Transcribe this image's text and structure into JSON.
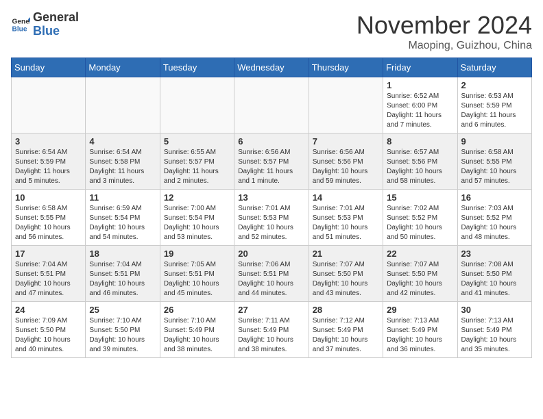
{
  "header": {
    "logo_general": "General",
    "logo_blue": "Blue",
    "month_title": "November 2024",
    "location": "Maoping, Guizhou, China"
  },
  "weekdays": [
    "Sunday",
    "Monday",
    "Tuesday",
    "Wednesday",
    "Thursday",
    "Friday",
    "Saturday"
  ],
  "weeks": [
    [
      {
        "day": "",
        "info": ""
      },
      {
        "day": "",
        "info": ""
      },
      {
        "day": "",
        "info": ""
      },
      {
        "day": "",
        "info": ""
      },
      {
        "day": "",
        "info": ""
      },
      {
        "day": "1",
        "info": "Sunrise: 6:52 AM\nSunset: 6:00 PM\nDaylight: 11 hours and 7 minutes."
      },
      {
        "day": "2",
        "info": "Sunrise: 6:53 AM\nSunset: 5:59 PM\nDaylight: 11 hours and 6 minutes."
      }
    ],
    [
      {
        "day": "3",
        "info": "Sunrise: 6:54 AM\nSunset: 5:59 PM\nDaylight: 11 hours and 5 minutes."
      },
      {
        "day": "4",
        "info": "Sunrise: 6:54 AM\nSunset: 5:58 PM\nDaylight: 11 hours and 3 minutes."
      },
      {
        "day": "5",
        "info": "Sunrise: 6:55 AM\nSunset: 5:57 PM\nDaylight: 11 hours and 2 minutes."
      },
      {
        "day": "6",
        "info": "Sunrise: 6:56 AM\nSunset: 5:57 PM\nDaylight: 11 hours and 1 minute."
      },
      {
        "day": "7",
        "info": "Sunrise: 6:56 AM\nSunset: 5:56 PM\nDaylight: 10 hours and 59 minutes."
      },
      {
        "day": "8",
        "info": "Sunrise: 6:57 AM\nSunset: 5:56 PM\nDaylight: 10 hours and 58 minutes."
      },
      {
        "day": "9",
        "info": "Sunrise: 6:58 AM\nSunset: 5:55 PM\nDaylight: 10 hours and 57 minutes."
      }
    ],
    [
      {
        "day": "10",
        "info": "Sunrise: 6:58 AM\nSunset: 5:55 PM\nDaylight: 10 hours and 56 minutes."
      },
      {
        "day": "11",
        "info": "Sunrise: 6:59 AM\nSunset: 5:54 PM\nDaylight: 10 hours and 54 minutes."
      },
      {
        "day": "12",
        "info": "Sunrise: 7:00 AM\nSunset: 5:54 PM\nDaylight: 10 hours and 53 minutes."
      },
      {
        "day": "13",
        "info": "Sunrise: 7:01 AM\nSunset: 5:53 PM\nDaylight: 10 hours and 52 minutes."
      },
      {
        "day": "14",
        "info": "Sunrise: 7:01 AM\nSunset: 5:53 PM\nDaylight: 10 hours and 51 minutes."
      },
      {
        "day": "15",
        "info": "Sunrise: 7:02 AM\nSunset: 5:52 PM\nDaylight: 10 hours and 50 minutes."
      },
      {
        "day": "16",
        "info": "Sunrise: 7:03 AM\nSunset: 5:52 PM\nDaylight: 10 hours and 48 minutes."
      }
    ],
    [
      {
        "day": "17",
        "info": "Sunrise: 7:04 AM\nSunset: 5:51 PM\nDaylight: 10 hours and 47 minutes."
      },
      {
        "day": "18",
        "info": "Sunrise: 7:04 AM\nSunset: 5:51 PM\nDaylight: 10 hours and 46 minutes."
      },
      {
        "day": "19",
        "info": "Sunrise: 7:05 AM\nSunset: 5:51 PM\nDaylight: 10 hours and 45 minutes."
      },
      {
        "day": "20",
        "info": "Sunrise: 7:06 AM\nSunset: 5:51 PM\nDaylight: 10 hours and 44 minutes."
      },
      {
        "day": "21",
        "info": "Sunrise: 7:07 AM\nSunset: 5:50 PM\nDaylight: 10 hours and 43 minutes."
      },
      {
        "day": "22",
        "info": "Sunrise: 7:07 AM\nSunset: 5:50 PM\nDaylight: 10 hours and 42 minutes."
      },
      {
        "day": "23",
        "info": "Sunrise: 7:08 AM\nSunset: 5:50 PM\nDaylight: 10 hours and 41 minutes."
      }
    ],
    [
      {
        "day": "24",
        "info": "Sunrise: 7:09 AM\nSunset: 5:50 PM\nDaylight: 10 hours and 40 minutes."
      },
      {
        "day": "25",
        "info": "Sunrise: 7:10 AM\nSunset: 5:50 PM\nDaylight: 10 hours and 39 minutes."
      },
      {
        "day": "26",
        "info": "Sunrise: 7:10 AM\nSunset: 5:49 PM\nDaylight: 10 hours and 38 minutes."
      },
      {
        "day": "27",
        "info": "Sunrise: 7:11 AM\nSunset: 5:49 PM\nDaylight: 10 hours and 38 minutes."
      },
      {
        "day": "28",
        "info": "Sunrise: 7:12 AM\nSunset: 5:49 PM\nDaylight: 10 hours and 37 minutes."
      },
      {
        "day": "29",
        "info": "Sunrise: 7:13 AM\nSunset: 5:49 PM\nDaylight: 10 hours and 36 minutes."
      },
      {
        "day": "30",
        "info": "Sunrise: 7:13 AM\nSunset: 5:49 PM\nDaylight: 10 hours and 35 minutes."
      }
    ]
  ]
}
